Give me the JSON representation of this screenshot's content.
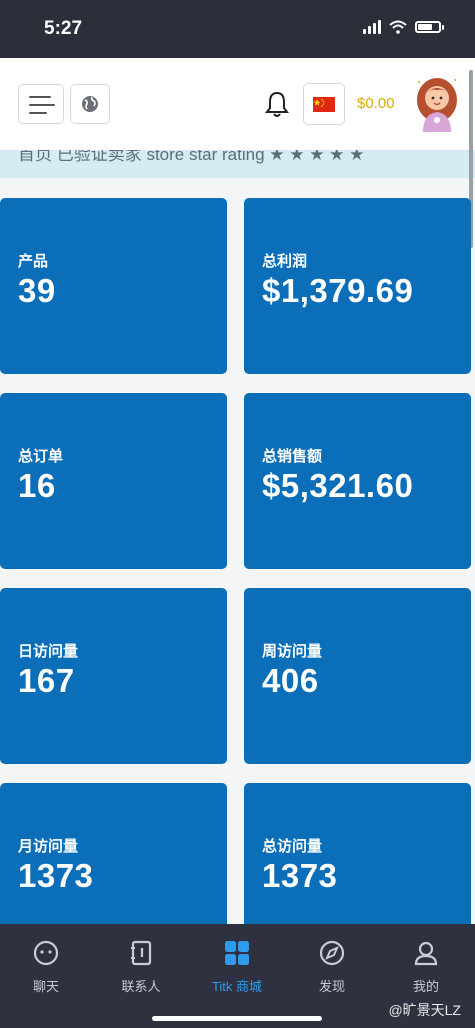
{
  "status_bar": {
    "time": "5:27"
  },
  "header": {
    "balance": "$0.00",
    "flag": "🇨🇳"
  },
  "notice": {
    "text": "首页 已验证卖家 store star rating ★ ★ ★ ★ ★"
  },
  "stats": [
    {
      "label": "产品",
      "value": "39"
    },
    {
      "label": "总利润",
      "value": "$1,379.69"
    },
    {
      "label": "总订单",
      "value": "16"
    },
    {
      "label": "总销售额",
      "value": "$5,321.60"
    },
    {
      "label": "日访问量",
      "value": "167"
    },
    {
      "label": "周访问量",
      "value": "406"
    },
    {
      "label": "月访问量",
      "value": "1373"
    },
    {
      "label": "总访问量",
      "value": "1373"
    }
  ],
  "bottom_nav": [
    {
      "label": "聊天",
      "icon": "chat-icon"
    },
    {
      "label": "联系人",
      "icon": "contacts-icon"
    },
    {
      "label": "Titk 商城",
      "icon": "grid-icon",
      "active": true
    },
    {
      "label": "发现",
      "icon": "compass-icon"
    },
    {
      "label": "我的",
      "icon": "user-icon"
    }
  ],
  "watermark": "@旷景天LZ",
  "colors": {
    "card": "#0a6eb8",
    "accent": "#2f9bea",
    "balance": "#e0a800"
  }
}
